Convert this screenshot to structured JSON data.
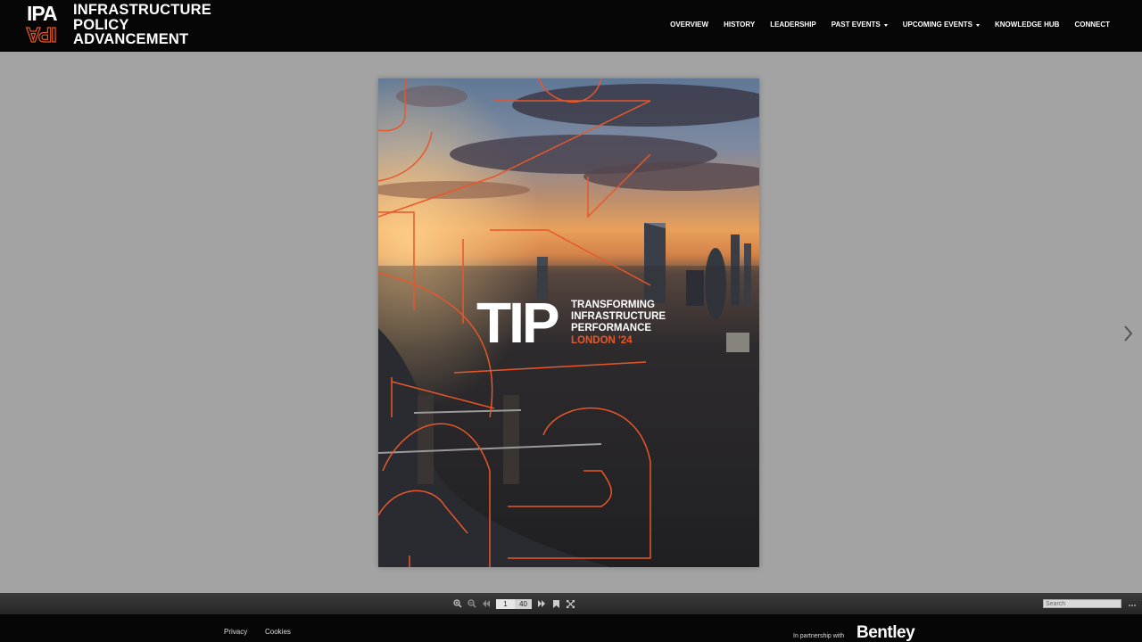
{
  "brand": {
    "mark": "IPA",
    "name_lines": [
      "INFRASTRUCTURE",
      "POLICY",
      "ADVANCEMENT"
    ]
  },
  "nav": {
    "items": [
      {
        "label": "OVERVIEW",
        "dropdown": false
      },
      {
        "label": "HISTORY",
        "dropdown": false
      },
      {
        "label": "LEADERSHIP",
        "dropdown": false
      },
      {
        "label": "PAST EVENTS",
        "dropdown": true
      },
      {
        "label": "UPCOMING EVENTS",
        "dropdown": true
      },
      {
        "label": "KNOWLEDGE HUB",
        "dropdown": false
      },
      {
        "label": "CONNECT",
        "dropdown": false
      }
    ]
  },
  "cover": {
    "title": "TIP",
    "subtitle_lines": [
      "TRANSFORMING",
      "INFRASTRUCTURE",
      "PERFORMANCE"
    ],
    "event": "LONDON '24",
    "accent_color": "#e8572a"
  },
  "viewer": {
    "current_page": "1",
    "total_pages": "40",
    "search_placeholder": "Search",
    "icons": [
      "zoom-in-icon",
      "zoom-out-icon",
      "first-page-icon",
      "last-page-icon",
      "bookmark-icon",
      "fullscreen-icon",
      "more-icon"
    ]
  },
  "footer": {
    "links": [
      "Privacy",
      "Cookies"
    ],
    "partner_text": "In partnership with",
    "partner_logo": "Bentley"
  }
}
